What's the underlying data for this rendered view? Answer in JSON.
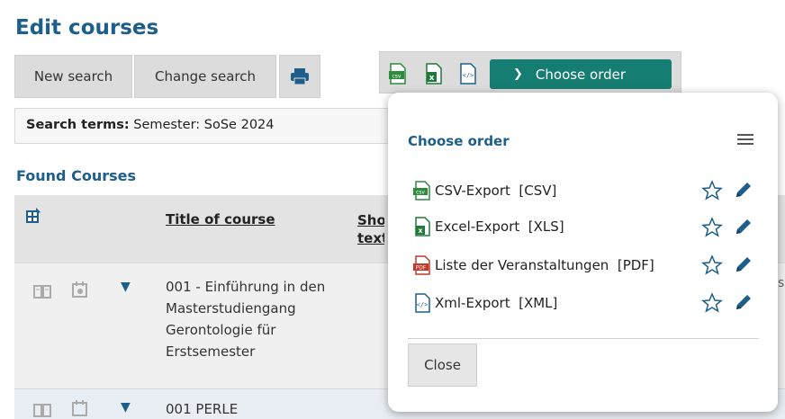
{
  "page": {
    "title": "Edit courses"
  },
  "toolbar": {
    "new_search_label": "New search",
    "change_search_label": "Change search",
    "print_icon": "printer-icon",
    "choose_order_label": "Choose order",
    "export_icons": [
      "csv-icon",
      "excel-icon",
      "xml-icon"
    ]
  },
  "search": {
    "terms_label": "Search terms:",
    "terms_value": " Semester: SoSe 2024"
  },
  "results": {
    "heading": "Found Courses",
    "columns": [
      "Title of course",
      "Short text"
    ],
    "rows": [
      {
        "title": "001 - Einführung in den Masterstudiengang Gerontologie für Erstsemester"
      },
      {
        "title": "001 PERLE"
      }
    ],
    "side_fragment": "s"
  },
  "popup": {
    "title": "Choose order",
    "items": [
      {
        "label": "CSV-Export  [CSV]",
        "icon": "csv-icon"
      },
      {
        "label": "Excel-Export  [XLS]",
        "icon": "excel-icon"
      },
      {
        "label": "Liste der Veranstaltungen  [PDF]",
        "icon": "pdf-icon"
      },
      {
        "label": "Xml-Export  [XML]",
        "icon": "xml-icon"
      }
    ],
    "close_label": "Close"
  },
  "colors": {
    "brand_blue": "#1d5f8a",
    "accent_teal": "#167d73",
    "csv_green": "#2e8b3e",
    "excel_green": "#1f7a3a",
    "pdf_red": "#c0392b"
  }
}
